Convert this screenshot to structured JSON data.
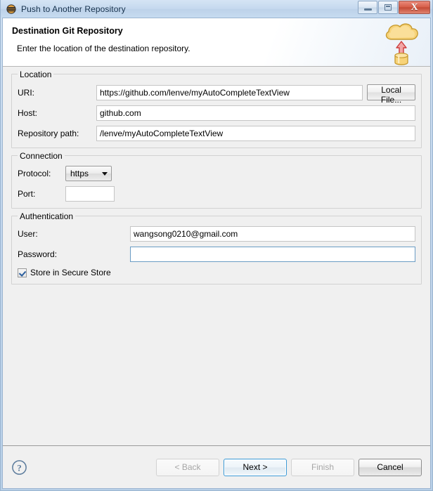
{
  "window": {
    "title": "Push to Another Repository",
    "icon": "eclipse-egit-icon",
    "buttons": {
      "minimize": "minimize-icon",
      "maximize": "restore-icon",
      "close": "X"
    }
  },
  "wizard": {
    "title": "Destination Git Repository",
    "subtitle": "Enter the location of the destination repository.",
    "banner_icon": "cloud-upload-icon"
  },
  "location": {
    "legend": "Location",
    "uri_label": "URI:",
    "uri_value": "https://github.com/lenve/myAutoCompleteTextView",
    "local_file_label": "Local File...",
    "host_label": "Host:",
    "host_value": "github.com",
    "path_label": "Repository path:",
    "path_value": "/lenve/myAutoCompleteTextView"
  },
  "connection": {
    "legend": "Connection",
    "protocol_label": "Protocol:",
    "protocol_value": "https",
    "protocol_options": [
      "https"
    ],
    "port_label": "Port:",
    "port_value": ""
  },
  "authentication": {
    "legend": "Authentication",
    "user_label": "User:",
    "user_value": "wangsong0210@gmail.com",
    "password_label": "Password:",
    "password_value": "",
    "store_label": "Store in Secure Store",
    "store_checked": true
  },
  "footer": {
    "help_icon": "help-question-icon",
    "back_label": "< Back",
    "next_label": "Next >",
    "finish_label": "Finish",
    "cancel_label": "Cancel"
  },
  "colors": {
    "titlebar": "#c2d6ec",
    "body": "#f0f0f0",
    "focus_blue": "#3c9ad6",
    "cloud_yellow": "#f5d27a",
    "arrow_red": "#e06a6a"
  }
}
